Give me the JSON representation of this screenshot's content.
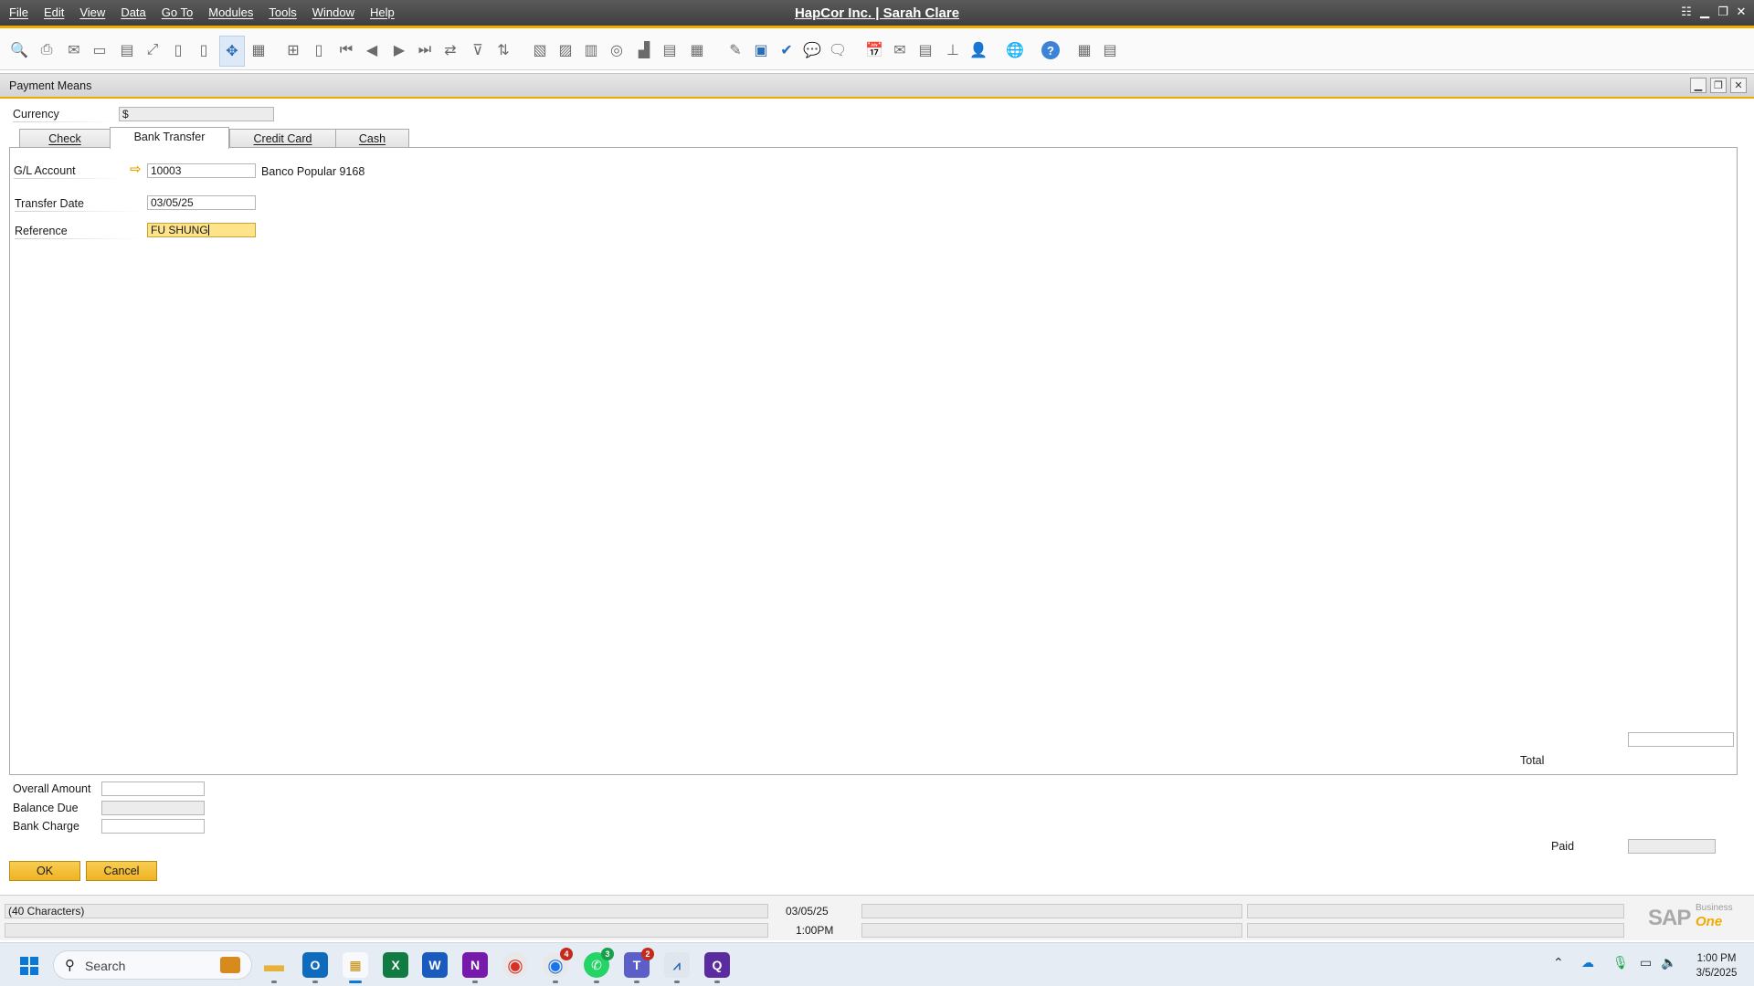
{
  "app": {
    "title": "HapCor Inc. | Sarah Clare",
    "menu": [
      "File",
      "Edit",
      "View",
      "Data",
      "Go To",
      "Modules",
      "Tools",
      "Window",
      "Help"
    ]
  },
  "window": {
    "title": "Payment Means"
  },
  "currency": {
    "label": "Currency",
    "value": "$"
  },
  "tabs": [
    {
      "label": "Check",
      "selected": false
    },
    {
      "label": "Bank Transfer",
      "selected": true
    },
    {
      "label": "Credit Card",
      "selected": false
    },
    {
      "label": "Cash",
      "selected": false
    }
  ],
  "bank_transfer": {
    "gl_account_label": "G/L Account",
    "gl_account_value": "10003",
    "gl_account_name": "Banco Popular 9168",
    "transfer_date_label": "Transfer Date",
    "transfer_date_value": "03/05/25",
    "reference_label": "Reference",
    "reference_value": "FU SHUNG"
  },
  "totals": {
    "total_label": "Total",
    "total_value": "",
    "overall_amount_label": "Overall Amount",
    "overall_amount_value": "",
    "balance_due_label": "Balance Due",
    "balance_due_value": "",
    "bank_charge_label": "Bank Charge",
    "bank_charge_value": "",
    "paid_label": "Paid",
    "paid_value": ""
  },
  "buttons": {
    "ok": "OK",
    "cancel": "Cancel"
  },
  "status": {
    "message": "(40 Characters)",
    "date": "03/05/25",
    "time": "1:00PM",
    "brand_business": "Business",
    "brand_one": "One"
  },
  "taskbar": {
    "search_placeholder": "Search",
    "clock_time": "1:00 PM",
    "clock_date": "3/5/2025",
    "badges": {
      "chrome": "4",
      "whatsapp": "3",
      "teams": "2"
    }
  },
  "colors": {
    "accent": "#f0ab00",
    "active_field": "#fde38a",
    "titlebar": "#4a4a4a"
  }
}
